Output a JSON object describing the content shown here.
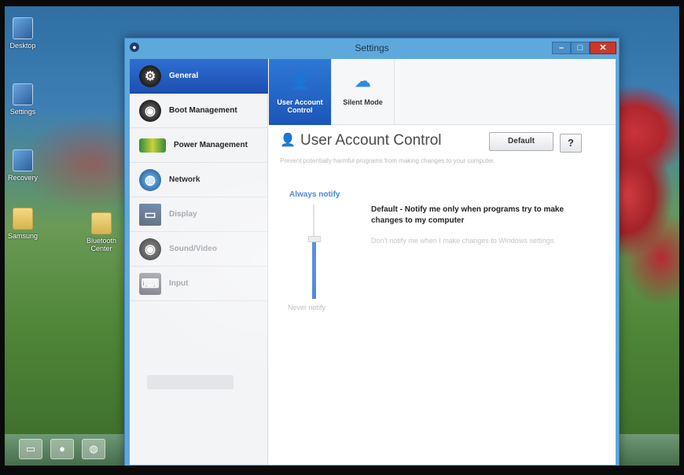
{
  "desktop": {
    "icons": [
      {
        "label": "Desktop",
        "type": "app"
      },
      {
        "label": "Settings",
        "type": "app"
      },
      {
        "label": "Recovery",
        "type": "app"
      },
      {
        "label": "Samsung",
        "type": "folder"
      },
      {
        "label": "Bluetooth Center",
        "type": "folder"
      }
    ],
    "taskbar": {
      "buttons": [
        "folder-icon",
        "user-icon",
        "globe-icon"
      ]
    }
  },
  "window": {
    "title": "Settings",
    "controls": {
      "minimize": "–",
      "maximize": "□",
      "close": "✕"
    }
  },
  "sidebar": {
    "items": [
      {
        "label": "General",
        "icon": "gear-icon",
        "state": "active"
      },
      {
        "label": "Boot Management",
        "icon": "boot-icon",
        "state": "normal"
      },
      {
        "label": "Power Management",
        "icon": "battery-icon",
        "state": "normal"
      },
      {
        "label": "Network",
        "icon": "globe-icon",
        "state": "normal"
      },
      {
        "label": "Display",
        "icon": "monitor-icon",
        "state": "faded"
      },
      {
        "label": "Sound/Video",
        "icon": "speaker-icon",
        "state": "faded"
      },
      {
        "label": "Input",
        "icon": "keyboard-icon",
        "state": "faded"
      }
    ]
  },
  "tabs": [
    {
      "label": "User Account Control",
      "icon": "user-shield-icon",
      "state": "active"
    },
    {
      "label": "Silent Mode",
      "icon": "silent-mode-icon",
      "state": "normal"
    }
  ],
  "content": {
    "title": "User Account Control",
    "default_button": "Default",
    "help_button": "?",
    "description": "Prevent potentially harmful programs from making changes to your computer.",
    "slider": {
      "top_label": "Always notify",
      "bottom_label": "Never notify",
      "level": 0.6
    },
    "setting_title": "Default - Notify me only when programs try to make changes to my computer",
    "setting_desc": "Don't notify me when I make changes to Windows settings."
  },
  "colors": {
    "accent": "#2f6fd2",
    "window_frame": "#5fa8dc",
    "close_button": "#c7392b",
    "slider_fill": "#2b6fd0"
  }
}
